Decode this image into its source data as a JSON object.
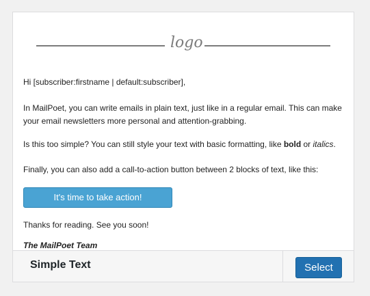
{
  "logo": {
    "text": "logo"
  },
  "email": {
    "greeting": "Hi [subscriber:firstname | default:subscriber],",
    "paragraph1": "In MailPoet, you can write emails in plain text, just like in a regular email. This can make your email newsletters more personal and attention-grabbing.",
    "paragraph2_prefix": "Is this too simple? You can still style your text with basic formatting, like ",
    "paragraph2_bold": "bold",
    "paragraph2_mid": " or ",
    "paragraph2_italic": "italics",
    "paragraph2_suffix": ".",
    "paragraph3": "Finally, you can also add a call-to-action button between 2 blocks of text, like this:",
    "cta_label": "It's time to take action!",
    "closing": "Thanks for reading. See you soon!",
    "signoff": "The MailPoet Team"
  },
  "footer": {
    "template_name": "Simple Text",
    "select_label": "Select"
  },
  "colors": {
    "cta_background": "#4aa3d3",
    "select_button": "#2271b1"
  }
}
